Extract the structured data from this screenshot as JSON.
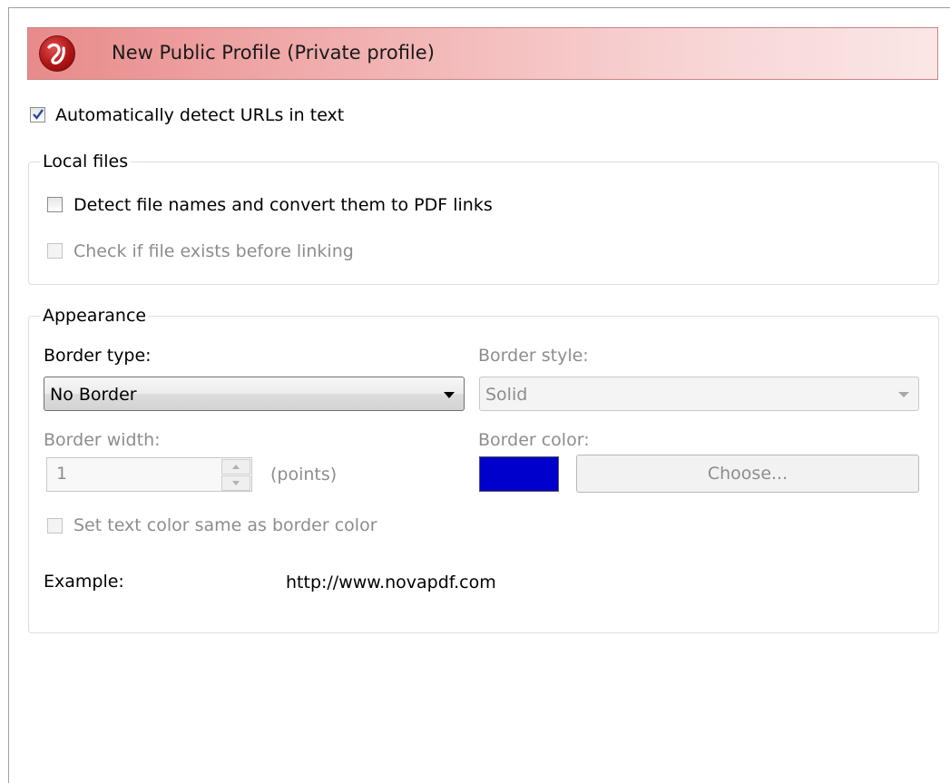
{
  "header": {
    "title": "New Public Profile (Private profile)",
    "icon": "novapdf-logo-icon"
  },
  "auto_detect": {
    "label": "Automatically detect URLs in text",
    "checked": true
  },
  "local_files": {
    "title": "Local files",
    "detect_file_names": {
      "label": "Detect file names and convert them to PDF links",
      "checked": false
    },
    "check_exists": {
      "label": "Check if file exists before linking",
      "checked": false,
      "disabled": true
    }
  },
  "appearance": {
    "title": "Appearance",
    "border_type": {
      "label": "Border type:",
      "value": "No Border"
    },
    "border_style": {
      "label": "Border style:",
      "value": "Solid"
    },
    "border_width": {
      "label": "Border width:",
      "value": "1",
      "unit": "(points)"
    },
    "border_color": {
      "label": "Border color:",
      "color": "#0000cc",
      "button": "Choose..."
    },
    "same_text_color": {
      "label": "Set text color same as border color",
      "checked": false,
      "disabled": true
    },
    "example": {
      "label": "Example:",
      "value": "http://www.novapdf.com"
    }
  },
  "colors": {
    "banner_start": "#e88a8a",
    "banner_end": "#fbe6e6",
    "disabled_text": "#8d8d8d"
  }
}
